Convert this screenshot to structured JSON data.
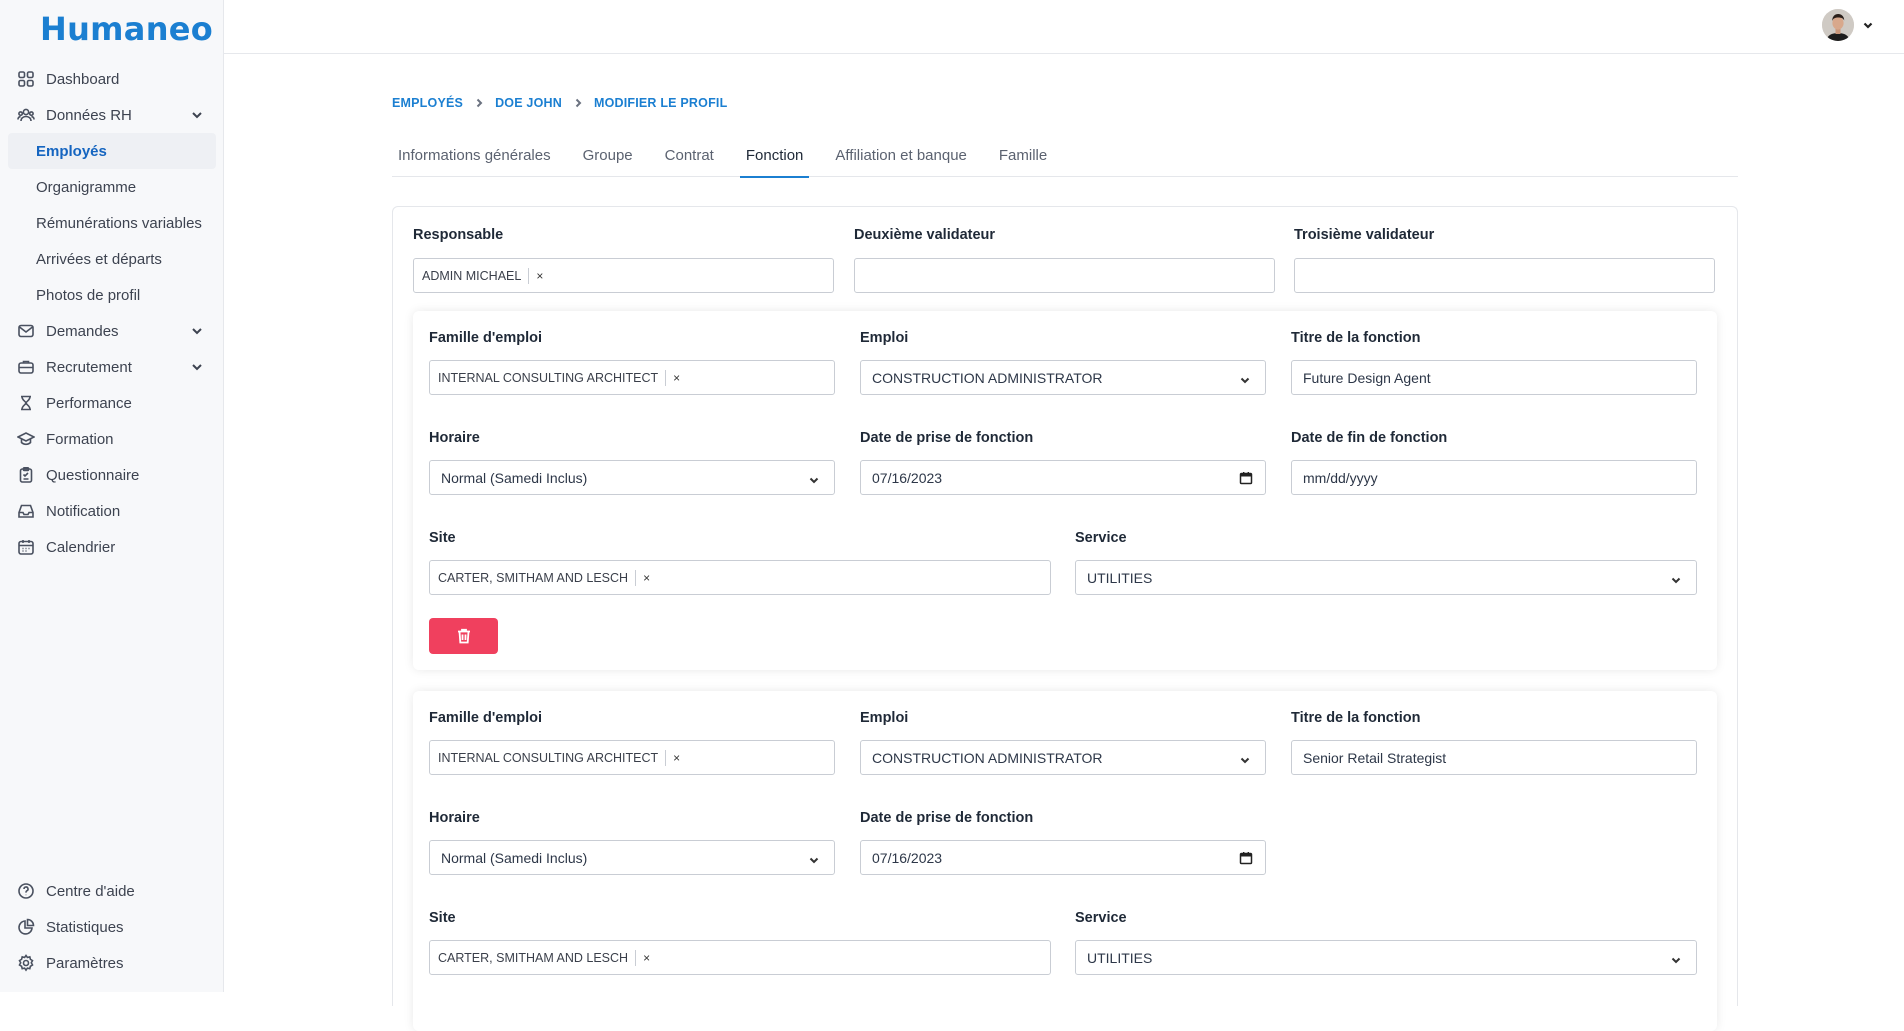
{
  "app": {
    "logo": "Humaneo"
  },
  "sidebar": {
    "items": [
      {
        "label": "Dashboard"
      },
      {
        "label": "Données RH"
      },
      {
        "label": "Demandes"
      },
      {
        "label": "Recrutement"
      },
      {
        "label": "Performance"
      },
      {
        "label": "Formation"
      },
      {
        "label": "Questionnaire"
      },
      {
        "label": "Notification"
      },
      {
        "label": "Calendrier"
      }
    ],
    "sub_items": [
      {
        "label": "Employés"
      },
      {
        "label": "Organigramme"
      },
      {
        "label": "Rémunérations variables"
      },
      {
        "label": "Arrivées et départs"
      },
      {
        "label": "Photos de profil"
      }
    ],
    "bottom": [
      {
        "label": "Centre d'aide"
      },
      {
        "label": "Statistiques"
      },
      {
        "label": "Paramètres"
      }
    ]
  },
  "breadcrumb": [
    "EMPLOYÉS",
    "DOE JOHN",
    "MODIFIER LE PROFIL"
  ],
  "tabs": [
    {
      "label": "Informations générales"
    },
    {
      "label": "Groupe"
    },
    {
      "label": "Contrat"
    },
    {
      "label": "Fonction"
    },
    {
      "label": "Affiliation et banque"
    },
    {
      "label": "Famille"
    }
  ],
  "validators": {
    "responsable_label": "Responsable",
    "responsable_value": "ADMIN MICHAEL",
    "second_label": "Deuxième validateur",
    "third_label": "Troisième validateur"
  },
  "labels": {
    "famille": "Famille d'emploi",
    "emploi": "Emploi",
    "titre": "Titre de la fonction",
    "horaire": "Horaire",
    "date_debut": "Date de prise de fonction",
    "date_fin": "Date de fin de fonction",
    "site": "Site",
    "service": "Service"
  },
  "functions": [
    {
      "famille": "INTERNAL CONSULTING ARCHITECT",
      "emploi": "CONSTRUCTION ADMINISTRATOR",
      "titre": "Future Design Agent",
      "horaire": "Normal (Samedi Inclus)",
      "date_debut": "07/16/2023",
      "date_fin": "mm/dd/yyyy",
      "site": "CARTER, SMITHAM AND LESCH",
      "service": "UTILITIES"
    },
    {
      "famille": "INTERNAL CONSULTING ARCHITECT",
      "emploi": "CONSTRUCTION ADMINISTRATOR",
      "titre": "Senior Retail Strategist",
      "horaire": "Normal (Samedi Inclus)",
      "date_debut": "07/16/2023",
      "site": "CARTER, SMITHAM AND LESCH",
      "service": "UTILITIES"
    }
  ],
  "colors": {
    "brand": "#1b7fd1",
    "danger": "#f0405e"
  }
}
